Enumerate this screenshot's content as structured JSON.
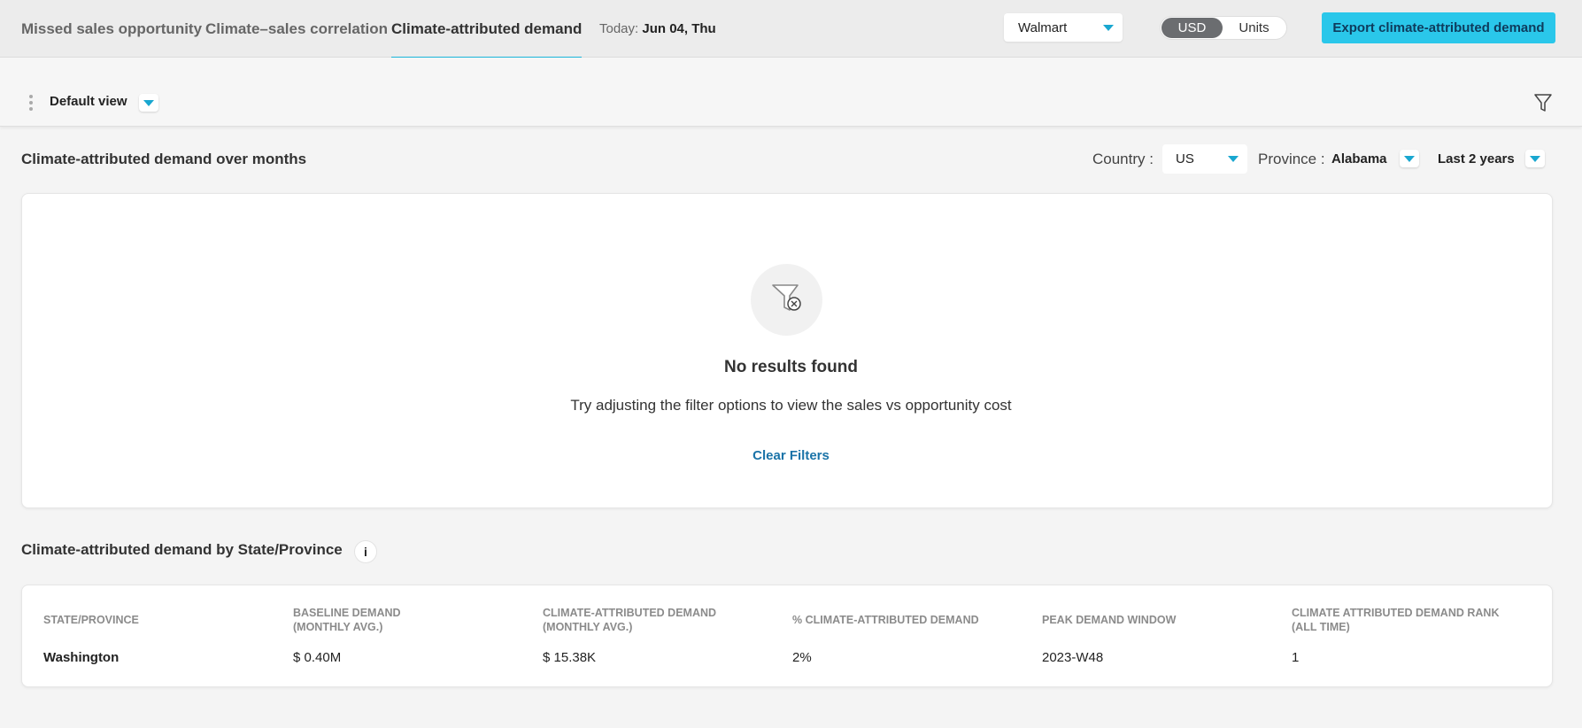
{
  "tabs": [
    {
      "label": "Missed sales opportunity"
    },
    {
      "label": "Climate–sales correlation"
    },
    {
      "label": "Climate-attributed demand"
    }
  ],
  "today": {
    "prefix": "Today:",
    "value": "Jun 04, Thu"
  },
  "retailer": {
    "selected": "Walmart"
  },
  "unit_toggle": {
    "options": [
      "USD",
      "Units"
    ],
    "selected": "USD"
  },
  "export_button": "Export climate-attributed demand",
  "view": {
    "label": "Default view"
  },
  "chart_section": {
    "title": "Climate-attributed demand over months",
    "country_label": "Country :",
    "country_value": "US",
    "province_label": "Province :",
    "province_value": "Alabama",
    "period_value": "Last 2 years",
    "empty_title": "No results found",
    "empty_subtitle": "Try adjusting the filter options to view the sales vs opportunity cost",
    "clear_filters": "Clear Filters"
  },
  "table_section": {
    "title": "Climate-attributed demand by State/Province",
    "info": "i",
    "columns": [
      [
        "STATE/PROVINCE"
      ],
      [
        "BASELINE DEMAND",
        "(MONTHLY AVG.)"
      ],
      [
        "CLIMATE-ATTRIBUTED DEMAND",
        "(MONTHLY AVG.)"
      ],
      [
        "% CLIMATE-ATTRIBUTED DEMAND"
      ],
      [
        "PEAK DEMAND WINDOW"
      ],
      [
        "CLIMATE ATTRIBUTED DEMAND RANK",
        "(ALL TIME)"
      ]
    ],
    "rows": [
      [
        "Washington",
        "$ 0.40M",
        "$ 15.38K",
        "2%",
        "2023-W48",
        "1"
      ]
    ]
  },
  "colors": {
    "accent": "#19b5d9",
    "export_bg": "#2ac7ea",
    "link": "#1a73a8"
  }
}
